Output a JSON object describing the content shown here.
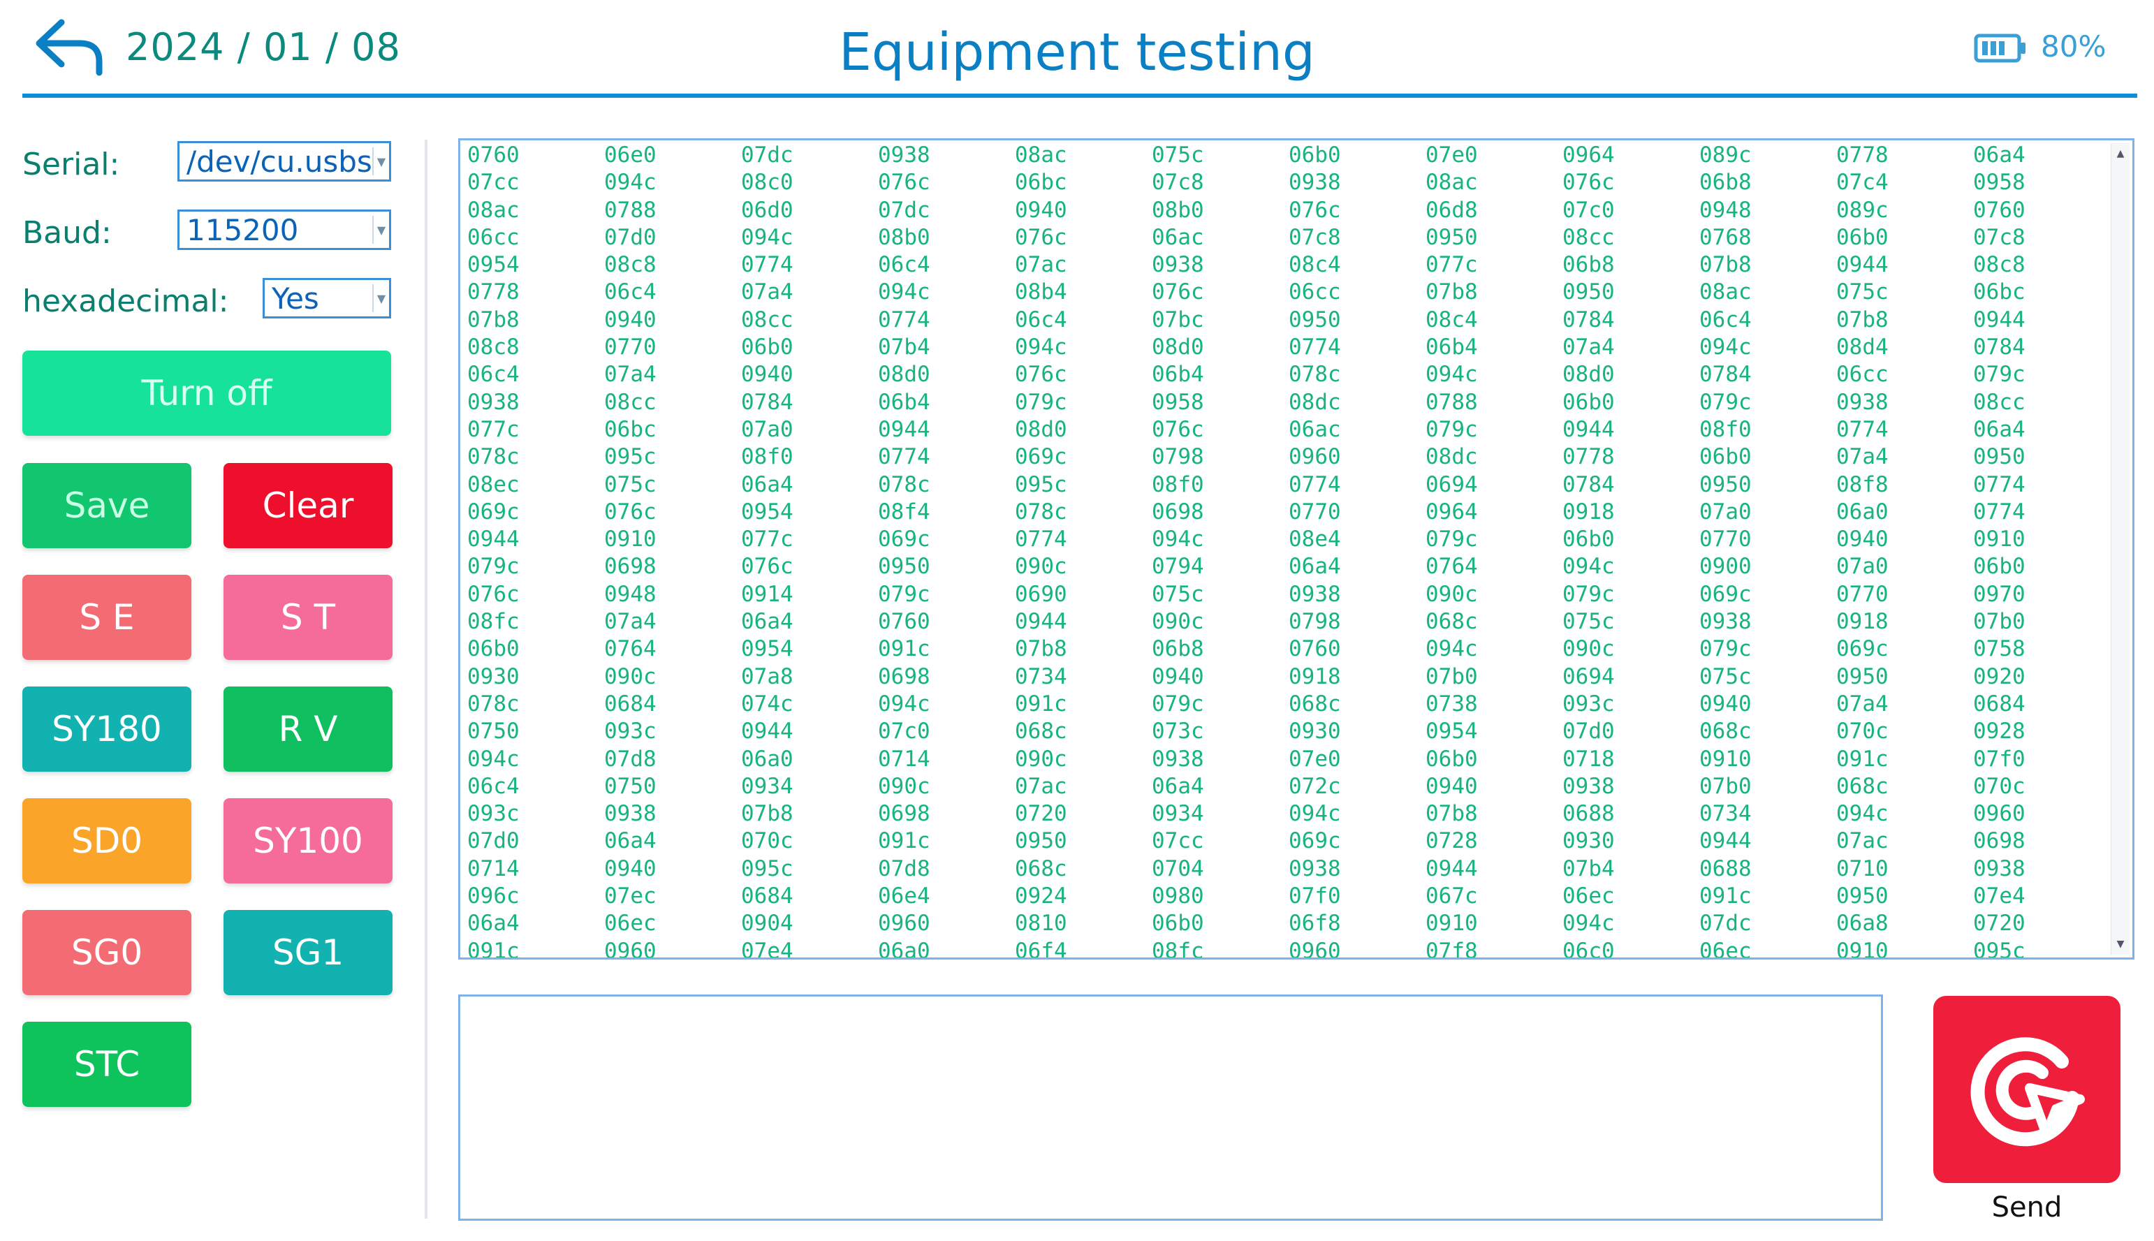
{
  "header": {
    "date": "2024 / 01 / 08",
    "title": "Equipment testing",
    "battery": "80%",
    "back_icon": "back-arrow-icon",
    "battery_icon": "battery-icon"
  },
  "settings": {
    "serial_label": "Serial:",
    "serial_value": "/dev/cu.usbs",
    "baud_label": "Baud:",
    "baud_value": "115200",
    "hex_label": "hexadecimal:",
    "hex_value": "Yes"
  },
  "buttons": {
    "turn_off": "Turn off",
    "save": "Save",
    "clear": "Clear",
    "se": "S E",
    "st": "S T",
    "sy180": "SY180",
    "rv": "R V",
    "sd0": "SD0",
    "sy100": "SY100",
    "sg0": "SG0",
    "sg1": "SG1",
    "stc": "STC"
  },
  "colors": {
    "turn_off": "#16e29a",
    "save": "#12c56f",
    "clear": "#ee0f2d",
    "se": "#f36b73",
    "st": "#f56b9a",
    "sy180": "#12b2b0",
    "rv": "#0fbf60",
    "sd0": "#fba42a",
    "sy100": "#f56b9a",
    "sg0": "#f36b73",
    "sg1": "#12b2b0",
    "stc": "#0fc35c",
    "accent": "#0a8fd8",
    "data_text": "#17b47e"
  },
  "data_rows": [
    [
      "0760",
      "06e0",
      "07dc",
      "0938",
      "08ac",
      "075c",
      "06b0",
      "07e0",
      "0964",
      "089c",
      "0778",
      "06a4"
    ],
    [
      "07cc",
      "094c",
      "08c0",
      "076c",
      "06bc",
      "07c8",
      "0938",
      "08ac",
      "076c",
      "06b8",
      "07c4",
      "0958"
    ],
    [
      "08ac",
      "0788",
      "06d0",
      "07dc",
      "0940",
      "08b0",
      "076c",
      "06d8",
      "07c0",
      "0948",
      "089c",
      "0760"
    ],
    [
      "06cc",
      "07d0",
      "094c",
      "08b0",
      "076c",
      "06ac",
      "07c8",
      "0950",
      "08cc",
      "0768",
      "06b0",
      "07c8"
    ],
    [
      "0954",
      "08c8",
      "0774",
      "06c4",
      "07ac",
      "0938",
      "08c4",
      "077c",
      "06b8",
      "07b8",
      "0944",
      "08c8"
    ],
    [
      "0778",
      "06c4",
      "07a4",
      "094c",
      "08b4",
      "076c",
      "06cc",
      "07b8",
      "0950",
      "08ac",
      "075c",
      "06bc"
    ],
    [
      "07b8",
      "0940",
      "08cc",
      "0774",
      "06c4",
      "07bc",
      "0950",
      "08c4",
      "0784",
      "06c4",
      "07b8",
      "0944"
    ],
    [
      "08c8",
      "0770",
      "06b0",
      "07b4",
      "094c",
      "08d0",
      "0774",
      "06b4",
      "07a4",
      "094c",
      "08d4",
      "0784"
    ],
    [
      "06c4",
      "07a4",
      "0940",
      "08d0",
      "076c",
      "06b4",
      "078c",
      "094c",
      "08d0",
      "0784",
      "06cc",
      "079c"
    ],
    [
      "0938",
      "08cc",
      "0784",
      "06b4",
      "079c",
      "0958",
      "08dc",
      "0788",
      "06b0",
      "079c",
      "0938",
      "08cc"
    ],
    [
      "077c",
      "06bc",
      "07a0",
      "0944",
      "08d0",
      "076c",
      "06ac",
      "079c",
      "0944",
      "08f0",
      "0774",
      "06a4"
    ],
    [
      "078c",
      "095c",
      "08f0",
      "0774",
      "069c",
      "0798",
      "0960",
      "08dc",
      "0778",
      "06b0",
      "07a4",
      "0950"
    ],
    [
      "08ec",
      "075c",
      "06a4",
      "078c",
      "095c",
      "08f0",
      "0774",
      "0694",
      "0784",
      "0950",
      "08f8",
      "0774"
    ],
    [
      "069c",
      "076c",
      "0954",
      "08f4",
      "078c",
      "0698",
      "0770",
      "0964",
      "0918",
      "07a0",
      "06a0",
      "0774"
    ],
    [
      "0944",
      "0910",
      "077c",
      "069c",
      "0774",
      "094c",
      "08e4",
      "079c",
      "06b0",
      "0770",
      "0940",
      "0910"
    ],
    [
      "079c",
      "0698",
      "076c",
      "0950",
      "090c",
      "0794",
      "06a4",
      "0764",
      "094c",
      "0900",
      "07a0",
      "06b0"
    ],
    [
      "076c",
      "0948",
      "0914",
      "079c",
      "0690",
      "075c",
      "0938",
      "090c",
      "079c",
      "069c",
      "0770",
      "0970"
    ],
    [
      "08fc",
      "07a4",
      "06a4",
      "0760",
      "0944",
      "090c",
      "0798",
      "068c",
      "075c",
      "0938",
      "0918",
      "07b0"
    ],
    [
      "06b0",
      "0764",
      "0954",
      "091c",
      "07b8",
      "06b8",
      "0760",
      "094c",
      "090c",
      "079c",
      "069c",
      "0758"
    ],
    [
      "0930",
      "090c",
      "07a8",
      "0698",
      "0734",
      "0940",
      "0918",
      "07b0",
      "0694",
      "075c",
      "0950",
      "0920"
    ],
    [
      "078c",
      "0684",
      "074c",
      "094c",
      "091c",
      "079c",
      "068c",
      "0738",
      "093c",
      "0940",
      "07a4",
      "0684"
    ],
    [
      "0750",
      "093c",
      "0944",
      "07c0",
      "068c",
      "073c",
      "0930",
      "0954",
      "07d0",
      "068c",
      "070c",
      "0928"
    ],
    [
      "094c",
      "07d8",
      "06a0",
      "0714",
      "090c",
      "0938",
      "07e0",
      "06b0",
      "0718",
      "0910",
      "091c",
      "07f0"
    ],
    [
      "06c4",
      "0750",
      "0934",
      "090c",
      "07ac",
      "06a4",
      "072c",
      "0940",
      "0938",
      "07b0",
      "068c",
      "070c"
    ],
    [
      "093c",
      "0938",
      "07b8",
      "0698",
      "0720",
      "0934",
      "094c",
      "07b8",
      "0688",
      "0734",
      "094c",
      "0960"
    ],
    [
      "07d0",
      "06a4",
      "070c",
      "091c",
      "0950",
      "07cc",
      "069c",
      "0728",
      "0930",
      "0944",
      "07ac",
      "0698"
    ],
    [
      "0714",
      "0940",
      "095c",
      "07d8",
      "068c",
      "0704",
      "0938",
      "0944",
      "07b4",
      "0688",
      "0710",
      "0938"
    ],
    [
      "096c",
      "07ec",
      "0684",
      "06e4",
      "0924",
      "0980",
      "07f0",
      "067c",
      "06ec",
      "091c",
      "0950",
      "07e4"
    ],
    [
      "06a4",
      "06ec",
      "0904",
      "0960",
      "0810",
      "06b0",
      "06f8",
      "0910",
      "094c",
      "07dc",
      "06a8",
      "0720"
    ],
    [
      "091c",
      "0960",
      "07e4",
      "06a0",
      "06f4",
      "08fc",
      "0960",
      "07f8",
      "06c0",
      "06ec",
      "0910",
      "095c"
    ]
  ],
  "send": {
    "input_value": "",
    "label": "Send",
    "icon": "send-target-icon"
  }
}
